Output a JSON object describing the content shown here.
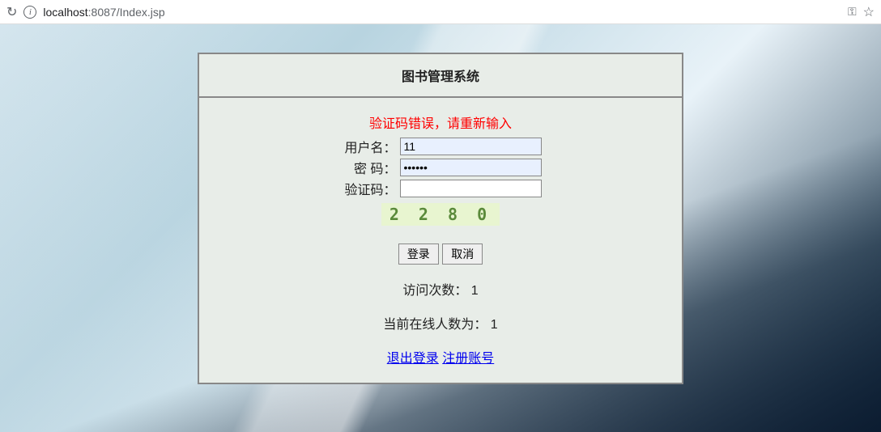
{
  "browser": {
    "url_host": "localhost",
    "url_port": ":8087",
    "url_path": "/Index.jsp"
  },
  "login": {
    "title": "图书管理系统",
    "error": "验证码错误，请重新输入",
    "labels": {
      "username": "用户名：",
      "password": "密 码：",
      "captcha": "验证码："
    },
    "values": {
      "username": "11",
      "password": "••••••",
      "captcha": ""
    },
    "captcha_image": "2 2 8 0",
    "buttons": {
      "login": "登录",
      "cancel": "取消"
    },
    "visit_count_label": "访问次数：",
    "visit_count_value": "1",
    "online_label": "当前在线人数为：",
    "online_value": "1",
    "links": {
      "logout": "退出登录",
      "register": "注册账号"
    }
  }
}
